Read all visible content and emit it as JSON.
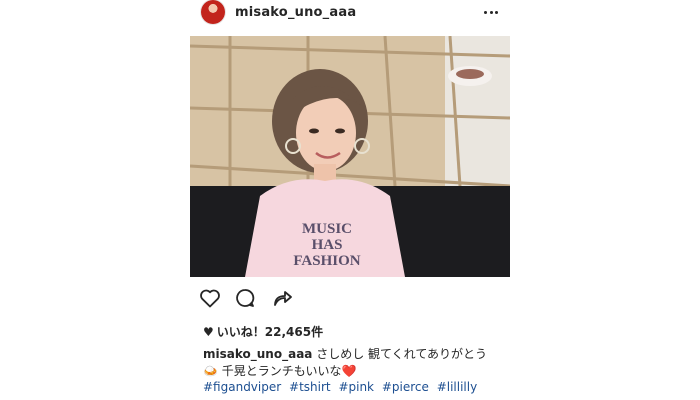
{
  "post": {
    "username": "misako_uno_aaa",
    "likes_text": "いいね！22,465件",
    "caption_user": "misako_uno_aaa",
    "caption_text": "さしめし 観てくれてありがとう 🍛 千晃とランチもいいな❤️",
    "hashtags": [
      "#figandviper",
      "#tshirt",
      "#pink",
      "#pierce",
      "#lillilly"
    ],
    "tshirt_text": [
      "MUSIC",
      "HAS",
      "FASHION"
    ]
  }
}
